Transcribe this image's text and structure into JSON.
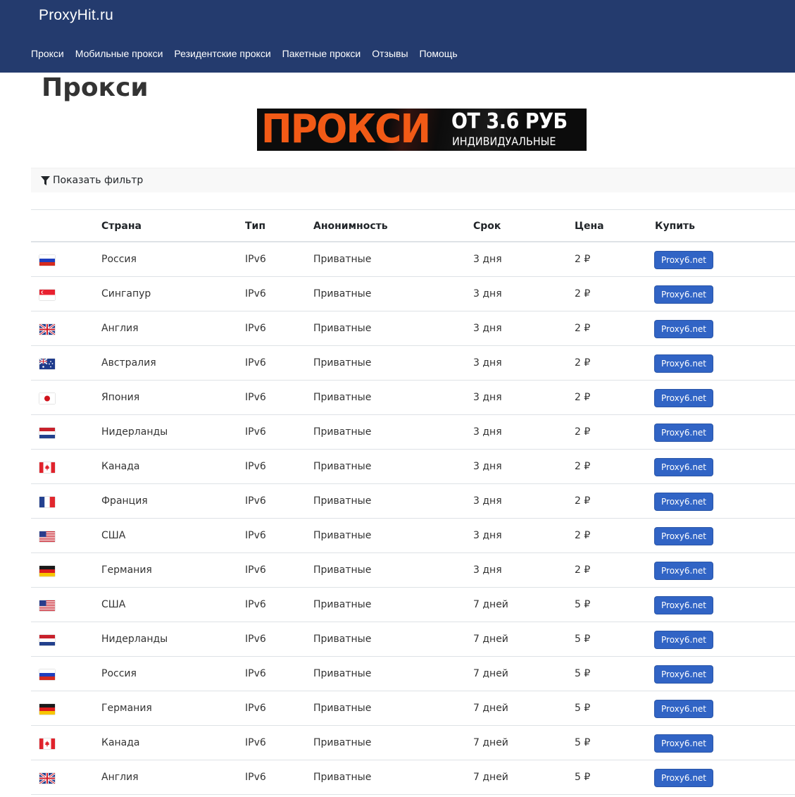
{
  "brand": "ProxyHit.ru",
  "nav": [
    "Прокси",
    "Мобильные прокси",
    "Резидентские прокси",
    "Пакетные прокси",
    "Отзывы",
    "Помощь"
  ],
  "page_title": "Прокси",
  "banner": {
    "big": "ПРОКСИ",
    "from": "ОТ 3.6 РУБ",
    "sub": "ИНДИВИДУАЛЬНЫЕ"
  },
  "filter": {
    "label": "Показать фильтр",
    "icon": "filter-icon"
  },
  "table": {
    "headers": {
      "country": "Страна",
      "type": "Тип",
      "anonymity": "Анонимность",
      "term": "Срок",
      "price": "Цена",
      "buy": "Купить"
    },
    "rows": [
      {
        "flag": "ru",
        "country": "Россия",
        "type": "IPv6",
        "anonymity": "Приватные",
        "term": "3 дня",
        "price": "2 ₽",
        "buy": "Proxy6.net"
      },
      {
        "flag": "sg",
        "country": "Сингапур",
        "type": "IPv6",
        "anonymity": "Приватные",
        "term": "3 дня",
        "price": "2 ₽",
        "buy": "Proxy6.net"
      },
      {
        "flag": "gb",
        "country": "Англия",
        "type": "IPv6",
        "anonymity": "Приватные",
        "term": "3 дня",
        "price": "2 ₽",
        "buy": "Proxy6.net"
      },
      {
        "flag": "au",
        "country": "Австралия",
        "type": "IPv6",
        "anonymity": "Приватные",
        "term": "3 дня",
        "price": "2 ₽",
        "buy": "Proxy6.net"
      },
      {
        "flag": "jp",
        "country": "Япония",
        "type": "IPv6",
        "anonymity": "Приватные",
        "term": "3 дня",
        "price": "2 ₽",
        "buy": "Proxy6.net"
      },
      {
        "flag": "nl",
        "country": "Нидерланды",
        "type": "IPv6",
        "anonymity": "Приватные",
        "term": "3 дня",
        "price": "2 ₽",
        "buy": "Proxy6.net"
      },
      {
        "flag": "ca",
        "country": "Канада",
        "type": "IPv6",
        "anonymity": "Приватные",
        "term": "3 дня",
        "price": "2 ₽",
        "buy": "Proxy6.net"
      },
      {
        "flag": "fr",
        "country": "Франция",
        "type": "IPv6",
        "anonymity": "Приватные",
        "term": "3 дня",
        "price": "2 ₽",
        "buy": "Proxy6.net"
      },
      {
        "flag": "us",
        "country": "США",
        "type": "IPv6",
        "anonymity": "Приватные",
        "term": "3 дня",
        "price": "2 ₽",
        "buy": "Proxy6.net"
      },
      {
        "flag": "de",
        "country": "Германия",
        "type": "IPv6",
        "anonymity": "Приватные",
        "term": "3 дня",
        "price": "2 ₽",
        "buy": "Proxy6.net"
      },
      {
        "flag": "us",
        "country": "США",
        "type": "IPv6",
        "anonymity": "Приватные",
        "term": "7 дней",
        "price": "5 ₽",
        "buy": "Proxy6.net"
      },
      {
        "flag": "nl",
        "country": "Нидерланды",
        "type": "IPv6",
        "anonymity": "Приватные",
        "term": "7 дней",
        "price": "5 ₽",
        "buy": "Proxy6.net"
      },
      {
        "flag": "ru",
        "country": "Россия",
        "type": "IPv6",
        "anonymity": "Приватные",
        "term": "7 дней",
        "price": "5 ₽",
        "buy": "Proxy6.net"
      },
      {
        "flag": "de",
        "country": "Германия",
        "type": "IPv6",
        "anonymity": "Приватные",
        "term": "7 дней",
        "price": "5 ₽",
        "buy": "Proxy6.net"
      },
      {
        "flag": "ca",
        "country": "Канада",
        "type": "IPv6",
        "anonymity": "Приватные",
        "term": "7 дней",
        "price": "5 ₽",
        "buy": "Proxy6.net"
      },
      {
        "flag": "gb",
        "country": "Англия",
        "type": "IPv6",
        "anonymity": "Приватные",
        "term": "7 дней",
        "price": "5 ₽",
        "buy": "Proxy6.net"
      }
    ]
  },
  "colors": {
    "navbar": "#243b6e",
    "button": "#3164c5",
    "banner_accent": "#f25a16"
  }
}
